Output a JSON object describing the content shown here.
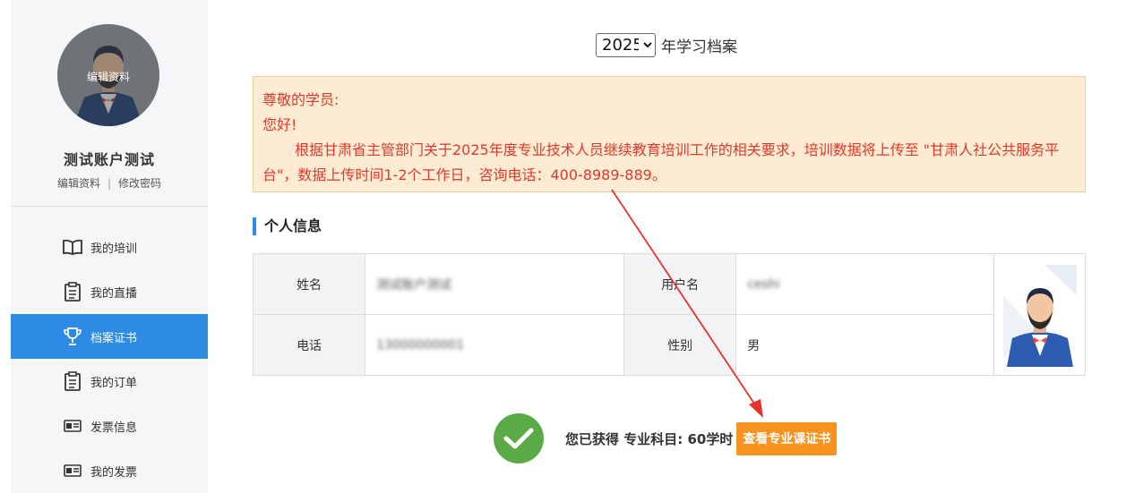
{
  "sidebar": {
    "avatar_edit_label": "编辑资料",
    "username": "测试账户测试",
    "edit_profile": "编辑资料",
    "separator": "|",
    "change_password": "修改密码",
    "menu": [
      {
        "label": "我的培训",
        "icon": "book-icon"
      },
      {
        "label": "我的直播",
        "icon": "clipboard-icon"
      },
      {
        "label": "档案证书",
        "icon": "trophy-icon"
      },
      {
        "label": "我的订单",
        "icon": "clipboard-icon"
      },
      {
        "label": "发票信息",
        "icon": "invoice-card-icon"
      },
      {
        "label": "我的发票",
        "icon": "invoice-card-icon"
      }
    ],
    "active_index": 2
  },
  "header": {
    "year_selected": "2025",
    "year_suffix": "年学习档案"
  },
  "notice": {
    "greeting": "尊敬的学员:",
    "hello": "您好!",
    "body": "根据甘肃省主管部门关于2025年度专业技术人员继续教育培训工作的相关要求，培训数据将上传至 \"甘肃人社公共服务平台\"，数据上传时间1-2个工作日，咨询电话：400-8989-889。"
  },
  "personal_info": {
    "section_title": "个人信息",
    "name_label": "姓名",
    "name_value": "测试账户测试",
    "username_label": "用户名",
    "username_value": "ceshi",
    "phone_label": "电话",
    "phone_value": "13000000001",
    "gender_label": "性别",
    "gender_value": "男"
  },
  "achievement": {
    "text": "您已获得 专业科目: 60学时",
    "button_label": "查看专业课证书"
  },
  "colors": {
    "accent": "#2d8be3",
    "notice_bg": "#fdebd3",
    "notice_text": "#e0392b",
    "button": "#f7931e",
    "check": "#5aaa45",
    "arrow": "#e5322d"
  }
}
